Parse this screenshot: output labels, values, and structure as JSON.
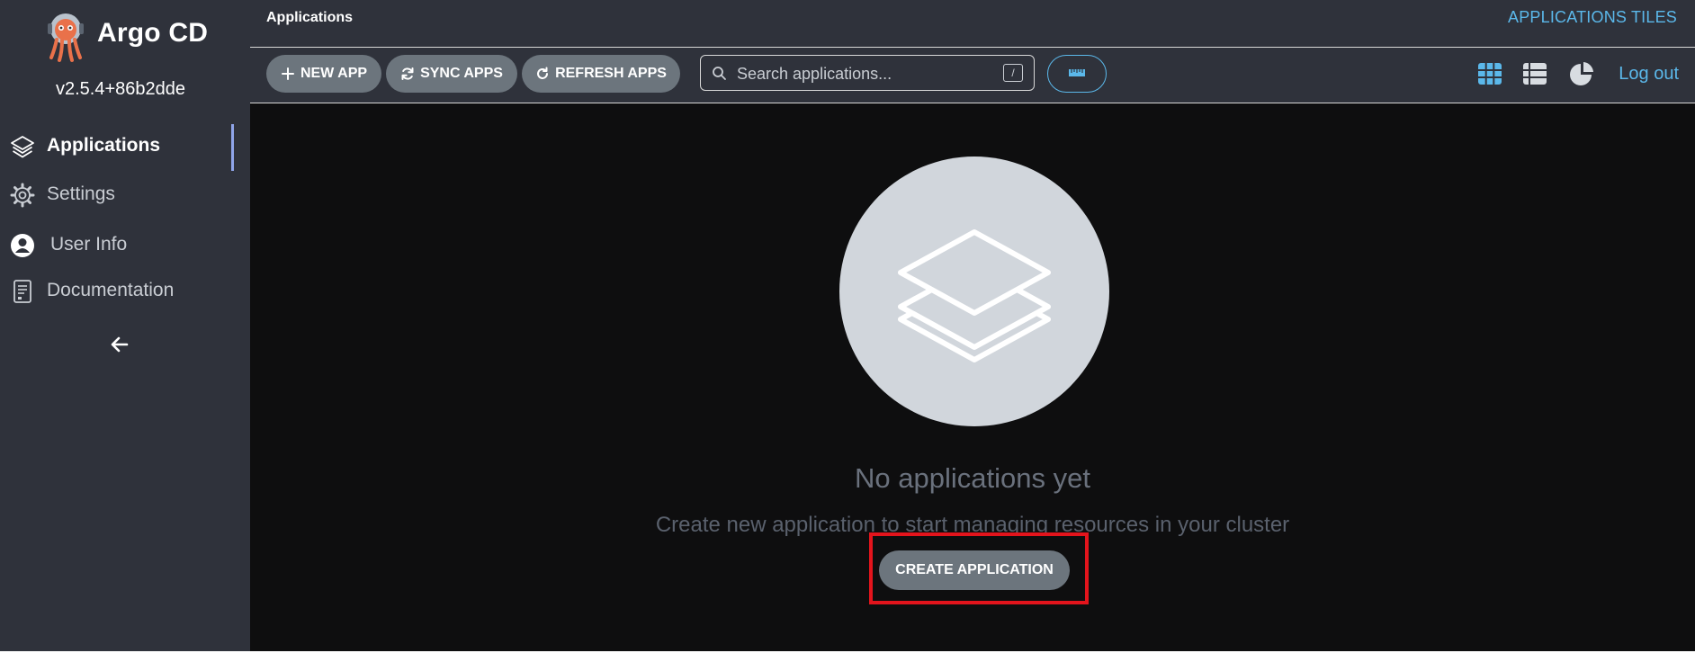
{
  "sidebar": {
    "brand": "Argo CD",
    "version": "v2.5.4+86b2dde",
    "items": [
      {
        "label": "Applications",
        "icon": "layers-icon",
        "active": true
      },
      {
        "label": "Settings",
        "icon": "gear-icon",
        "active": false
      },
      {
        "label": "User Info",
        "icon": "user-circle-icon",
        "active": false
      },
      {
        "label": "Documentation",
        "icon": "book-icon",
        "active": false
      }
    ],
    "collapse_icon": "arrow-left-icon"
  },
  "header": {
    "breadcrumb": "Applications",
    "title": "APPLICATIONS TILES"
  },
  "toolbar": {
    "new_app": "NEW APP",
    "sync_apps": "SYNC APPS",
    "refresh_apps": "REFRESH APPS",
    "search_placeholder": "Search applications...",
    "search_shortcut": "/",
    "logout": "Log out"
  },
  "empty_state": {
    "title": "No applications yet",
    "subtitle": "Create new application to start managing resources in your cluster",
    "button": "CREATE APPLICATION"
  },
  "colors": {
    "sidebar_bg": "#2f323b",
    "main_bg": "#0e0e0f",
    "accent": "#5bb8ea",
    "button_bg": "#6c757d",
    "highlight": "#e3141c"
  }
}
